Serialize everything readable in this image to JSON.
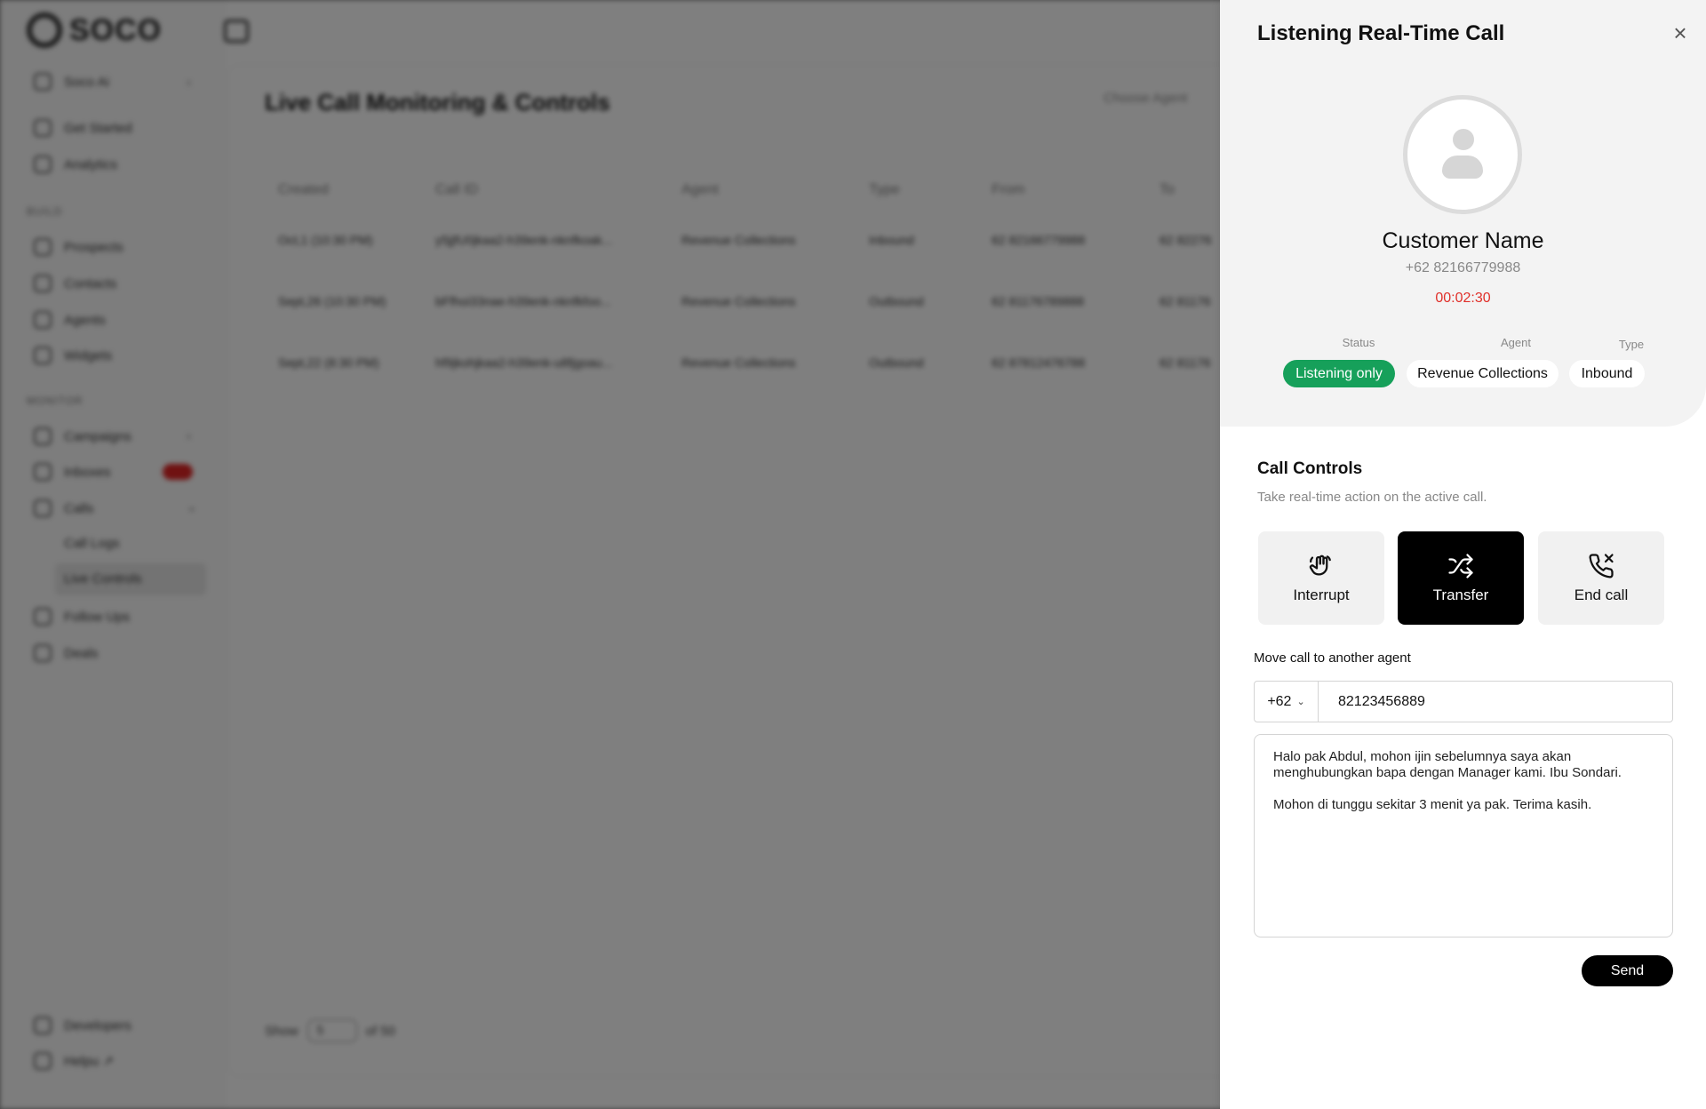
{
  "background": {
    "sidebar": {
      "logo": "SOCO",
      "workspace": "Soco Ai",
      "items_top": [
        "Get Started",
        "Analytics"
      ],
      "section_build": "BUILD",
      "items_build": [
        "Prospects",
        "Contacts",
        "Agents",
        "Widgets"
      ],
      "section_monitor": "MONITOR",
      "items_monitor": [
        "Campaigns",
        "Inboxes",
        "Calls"
      ],
      "calls_sub": [
        "Call Logs",
        "Live Controls"
      ],
      "items_after": [
        "Follow Ups",
        "Deals"
      ],
      "items_bottom": [
        "Developers",
        "Helpu ↗"
      ]
    },
    "main": {
      "title": "Live Call Monitoring & Controls",
      "choose_agent": "Choose Agent",
      "columns": [
        "Created",
        "Call ID",
        "Agent",
        "Type",
        "From",
        "To"
      ],
      "rows": [
        [
          "Oct,1 (10:30 PM)",
          "y5jjfU0jkaa2-h39enk-nknfkoak...",
          "Revenue Collections",
          "Inbound",
          "62 82166779988",
          "62 82276"
        ],
        [
          "Sept,26 (10:30 PM)",
          "bFfhoi33nae-h39enk-nknfkfoo...",
          "Revenue Collections",
          "Outbound",
          "62 81176789888",
          "62 81176"
        ],
        [
          "Sept,22 (8:30 PM)",
          "hf9jkohjkaa2-h39enk-u8fjgoau...",
          "Revenue Collections",
          "Outbound",
          "62 87812476788",
          "62 81176"
        ]
      ],
      "show_label": "Show",
      "show_value": "5",
      "of_label": "of 50"
    }
  },
  "panel": {
    "title": "Listening Real-Time Call",
    "customer_name": "Customer Name",
    "customer_phone": "+62 82166779988",
    "timer": "00:02:30",
    "status_label": "Status",
    "status_value": "Listening only",
    "agent_label": "Agent",
    "agent_value": "Revenue Collections",
    "type_label": "Type",
    "type_value": "Inbound",
    "controls_title": "Call Controls",
    "controls_subtitle": "Take real-time action on the active call.",
    "buttons": {
      "interrupt": "Interrupt",
      "transfer": "Transfer",
      "end_call": "End call"
    },
    "move_label": "Move call to another agent",
    "country_code": "+62",
    "phone_number": "82123456889",
    "message": "Halo pak Abdul, mohon ijin sebelumnya saya akan menghubungkan bapa dengan Manager kami. Ibu Sondari.\n\nMohon di tunggu sekitar 3 menit ya pak. Terima kasih.",
    "send_label": "Send"
  },
  "colors": {
    "status_green": "#16a05a",
    "timer_red": "#e0302a",
    "active_button": "#000000",
    "badge_red": "#e02424"
  }
}
